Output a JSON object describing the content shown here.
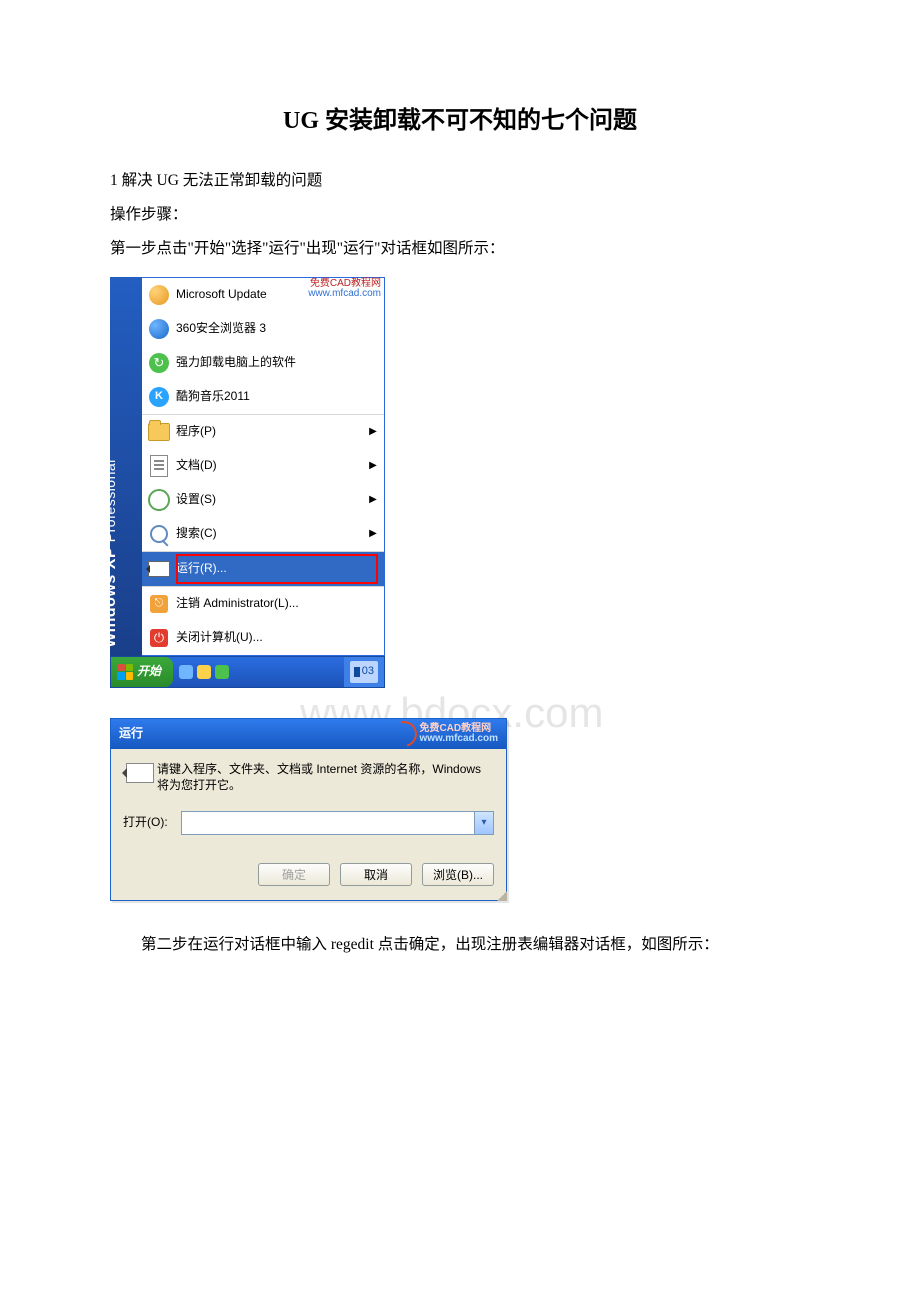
{
  "doc": {
    "title": "UG 安装卸载不可不知的七个问题",
    "line1": "1 解决 UG 无法正常卸载的问题",
    "line2": "操作步骤：",
    "line3": "第一步点击\"开始\"选择\"运行\"出现\"运行\"对话框如图所示：",
    "line4": "第二步在运行对话框中输入 regedit 点击确定，出现注册表编辑器对话框，如图所示："
  },
  "watermark": "www.bdocx.com",
  "wmcad_line1": "免费CAD教程网",
  "wmcad_line2": "www.mfcad.com",
  "startmenu": {
    "sidebar_product": "Windows XP",
    "sidebar_edition": "Professional",
    "items": [
      {
        "icon": "msupdate",
        "label": "Microsoft Update"
      },
      {
        "icon": "ie",
        "label": "360安全浏览器 3"
      },
      {
        "icon": "strong",
        "label": "强力卸载电脑上的软件"
      },
      {
        "icon": "kugou",
        "label": "酷狗音乐2011"
      }
    ],
    "system": [
      {
        "icon": "folder",
        "label": "程序(P)",
        "arrow": true
      },
      {
        "icon": "doc",
        "label": "文档(D)",
        "arrow": true
      },
      {
        "icon": "gear",
        "label": "设置(S)",
        "arrow": true
      },
      {
        "icon": "search",
        "label": "搜索(C)",
        "arrow": true
      },
      {
        "icon": "run",
        "label": "运行(R)...",
        "arrow": false,
        "highlight": true
      }
    ],
    "footer": [
      {
        "icon": "logoff",
        "label": "注销 Administrator(L)..."
      },
      {
        "icon": "power",
        "label": "关闭计算机(U)..."
      }
    ],
    "taskbar_start": "开始",
    "taskbar_lang": "03"
  },
  "rundialog": {
    "title": "运行",
    "info_text": "请键入程序、文件夹、文档或 Internet 资源的名称，Windows 将为您打开它。",
    "open_label": "打开(O):",
    "input_value": "",
    "btn_ok": "确定",
    "btn_cancel": "取消",
    "btn_browse": "浏览(B)..."
  }
}
